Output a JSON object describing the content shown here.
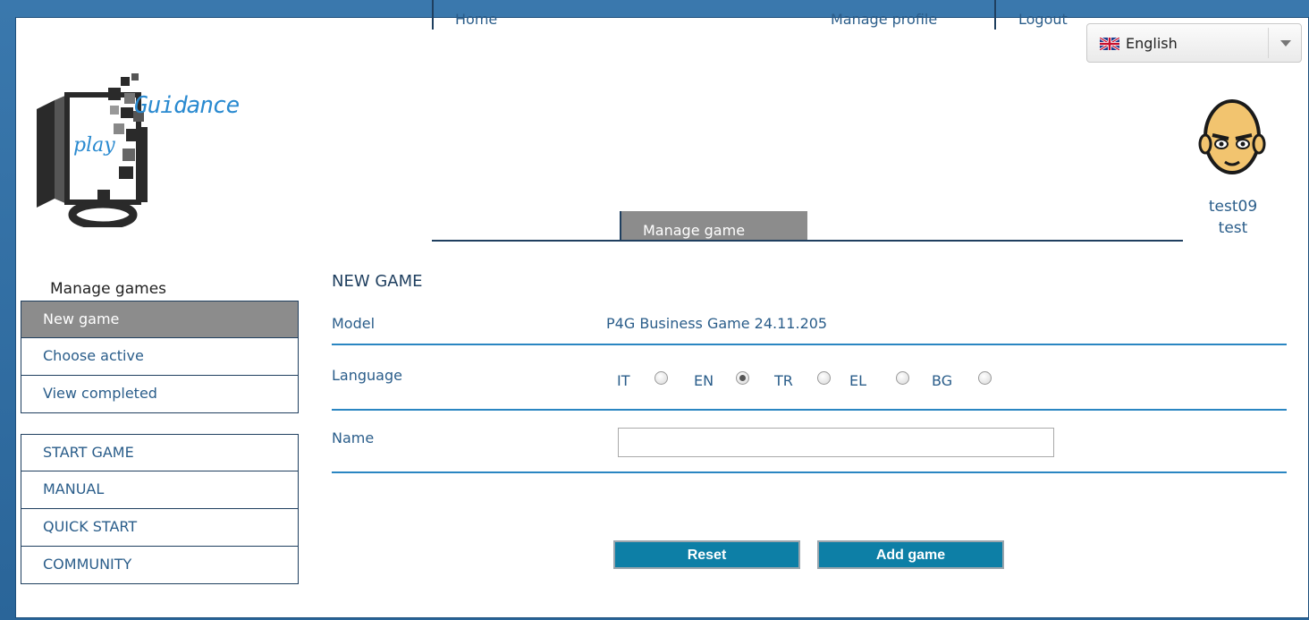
{
  "language_selector": {
    "selected": "English",
    "flag_icon": "uk-flag-icon"
  },
  "logo": {
    "text_top": "Guidance",
    "text_bottom": "play"
  },
  "user": {
    "username": "test09",
    "name": "test",
    "avatar_icon": "cartoon-face-avatar"
  },
  "nav": {
    "items": [
      {
        "label": "Home",
        "active": false
      },
      {
        "label": "Manage game",
        "active": true
      },
      {
        "label": "Manage profile",
        "active": false
      },
      {
        "label": "Logout",
        "active": false
      }
    ]
  },
  "sidebar": {
    "title": "Manage games",
    "group1": [
      {
        "label": "New game",
        "active": true
      },
      {
        "label": "Choose active",
        "active": false
      },
      {
        "label": "View completed",
        "active": false
      }
    ],
    "group2": [
      {
        "label": "START GAME"
      },
      {
        "label": "MANUAL"
      },
      {
        "label": "QUICK START"
      },
      {
        "label": "COMMUNITY"
      }
    ]
  },
  "form": {
    "title": "NEW GAME",
    "model_label": "Model",
    "model_value": "P4G Business Game 24.11.205",
    "language_label": "Language",
    "languages": [
      {
        "code": "IT",
        "checked": false
      },
      {
        "code": "EN",
        "checked": true
      },
      {
        "code": "TR",
        "checked": false
      },
      {
        "code": "EL",
        "checked": false
      },
      {
        "code": "BG",
        "checked": false
      }
    ],
    "name_label": "Name",
    "name_value": "",
    "reset_label": "Reset",
    "add_label": "Add game"
  },
  "colors": {
    "background": "#2f6c9e",
    "accent_blue": "#2a86c2",
    "button": "#0d7fa6",
    "active_gray": "#8c8c8c",
    "text_blue": "#2a5d8a"
  }
}
